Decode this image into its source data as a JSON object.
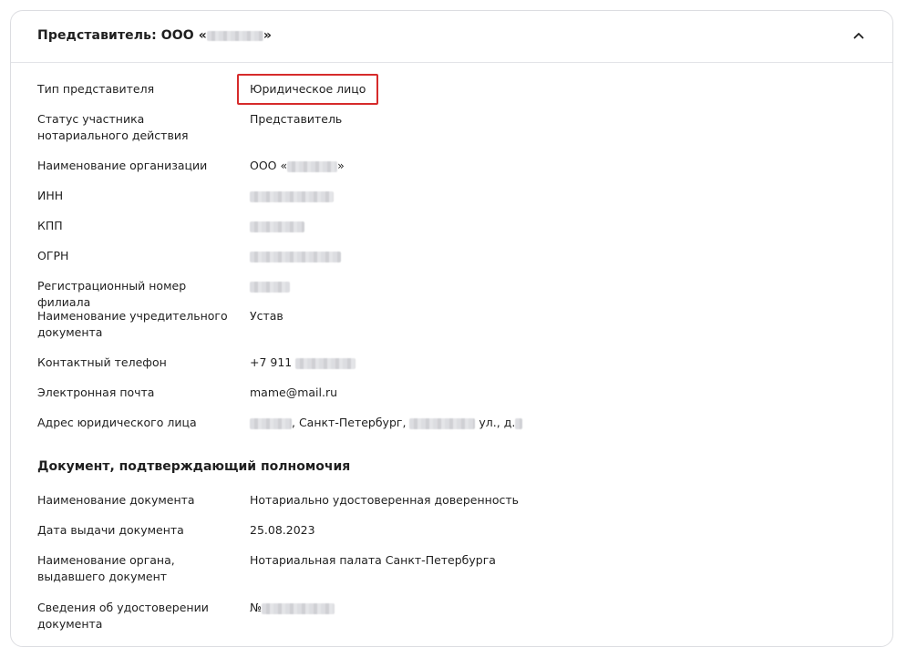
{
  "header": {
    "title_prefix": "Представитель: ООО «",
    "title_suffix": "»"
  },
  "representative": {
    "type_label": "Тип представителя",
    "type_value": "Юридическое лицо",
    "status_label": "Статус участника нотариального действия",
    "status_value": "Представитель",
    "org_name_label": "Наименование организации",
    "org_name_prefix": "ООО «",
    "org_name_suffix": "»",
    "inn_label": "ИНН",
    "kpp_label": "КПП",
    "ogrn_label": "ОГРН",
    "branch_label": "Регистрационный номер филиала",
    "founding_doc_label": "Наименование учредительного документа",
    "founding_doc_value": "Устав",
    "phone_label": "Контактный телефон",
    "phone_prefix": "+7 911",
    "email_label": "Электронная почта",
    "email_value": "mame@mail.ru",
    "address_label": "Адрес юридического лица",
    "address_city": ", Санкт-Петербург,",
    "address_street": "ул., д."
  },
  "authority_doc": {
    "section_title": "Документ, подтверждающий полномочия",
    "doc_name_label": "Наименование документа",
    "doc_name_value": "Нотариально удостоверенная доверенность",
    "issue_date_label": "Дата выдачи документа",
    "issue_date_value": "25.08.2023",
    "issuer_label": "Наименование органа, выдавшего документ",
    "issuer_value": "Нотариальная палата Санкт-Петербурга",
    "cert_label": "Сведения об удостоверении документа",
    "cert_prefix": "№"
  }
}
